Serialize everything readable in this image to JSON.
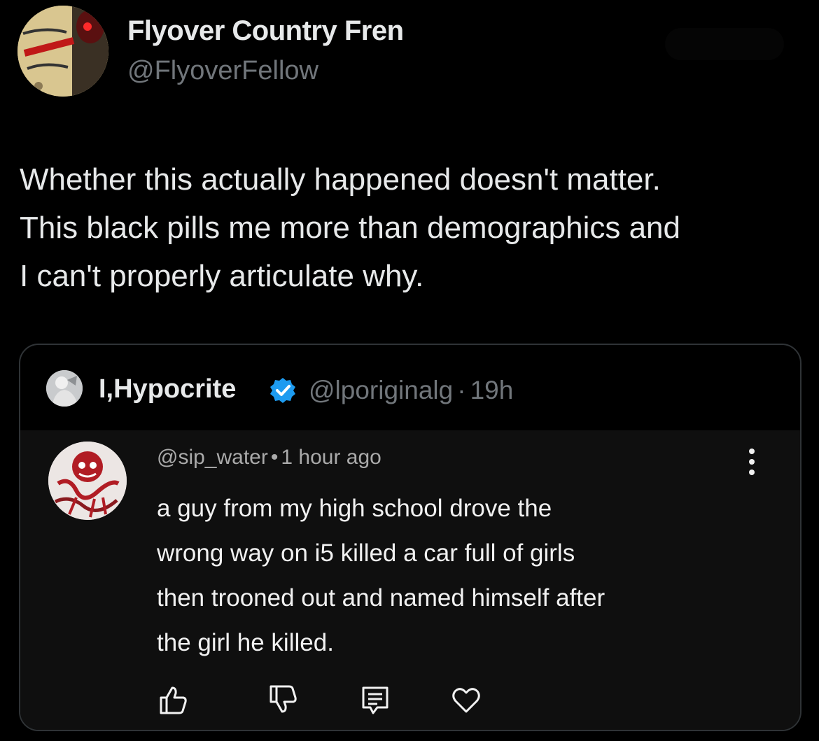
{
  "tweet": {
    "author": {
      "name": "Flyover Country Fren",
      "handle": "@FlyoverFellow",
      "avatar_icon": "cancelled-dreams-avatar"
    },
    "text_lines": [
      "Whether this actually happened doesn't matter.",
      "This black pills me more than demographics and",
      "I can't properly articulate why."
    ]
  },
  "quote": {
    "author": {
      "name": "I,Hypocrite",
      "handle": "@lporiginalg",
      "time": "19h",
      "separator": "·",
      "verified_color": "#1d9bf0",
      "avatar_icon": "statue-avatar"
    },
    "comment": {
      "username": "@sip_water",
      "separator": "•",
      "time": "1 hour ago",
      "text_lines": [
        "a guy from my high school drove the",
        "wrong way on i5 killed a car full of girls",
        "then trooned out and named himself after",
        "the girl he killed."
      ],
      "avatar_icon": "red-art-avatar",
      "actions": [
        "thumbs-up-icon",
        "thumbs-down-icon",
        "reply-icon",
        "heart-icon"
      ]
    }
  }
}
